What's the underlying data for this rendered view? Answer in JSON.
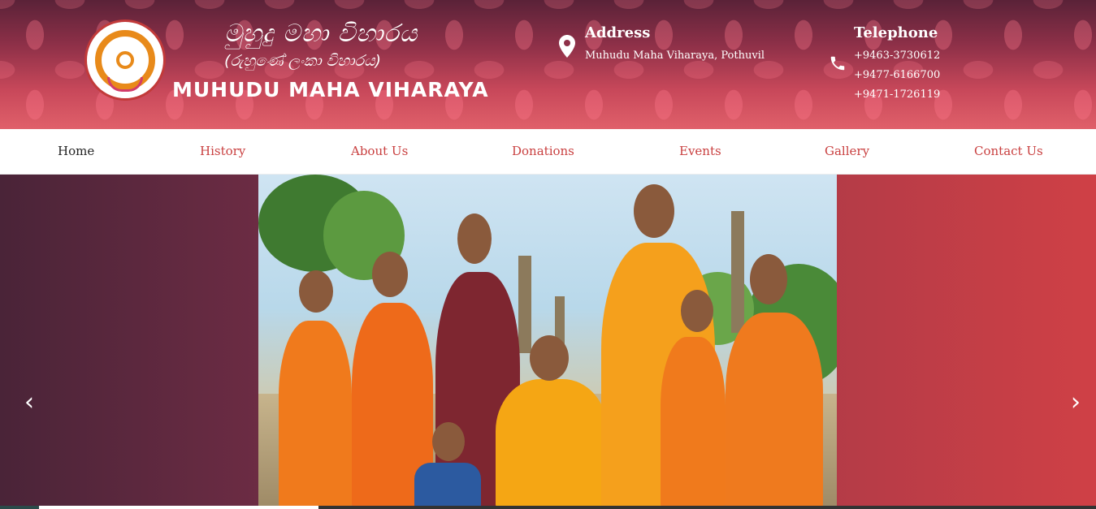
{
  "header": {
    "sinhala_title": "මුහුදු මහා විහාරය",
    "sinhala_subtitle": "(රුහුණේ ලංකා විහාරය)",
    "brand_name": "MUHUDU MAHA VIHARAYA",
    "address": {
      "heading": "Address",
      "value": "Muhudu Maha Viharaya, Pothuvil"
    },
    "telephone": {
      "heading": "Telephone",
      "numbers": [
        "+9463-3730612",
        "+9477-6166700",
        "+9471-1726119"
      ]
    }
  },
  "nav": {
    "items": [
      {
        "label": "Home",
        "active": true
      },
      {
        "label": "History"
      },
      {
        "label": "About Us"
      },
      {
        "label": "Donations"
      },
      {
        "label": "Events"
      },
      {
        "label": "Gallery"
      },
      {
        "label": "Contact Us"
      }
    ]
  },
  "slider": {
    "prev_icon": "chevron-left-icon",
    "next_icon": "chevron-right-icon",
    "prev_glyph": "‹",
    "next_glyph": "›",
    "progress_fraction": 0.29
  },
  "colors": {
    "accent": "#c94040",
    "header_dark": "#5a2238",
    "header_light": "#e0606a"
  }
}
